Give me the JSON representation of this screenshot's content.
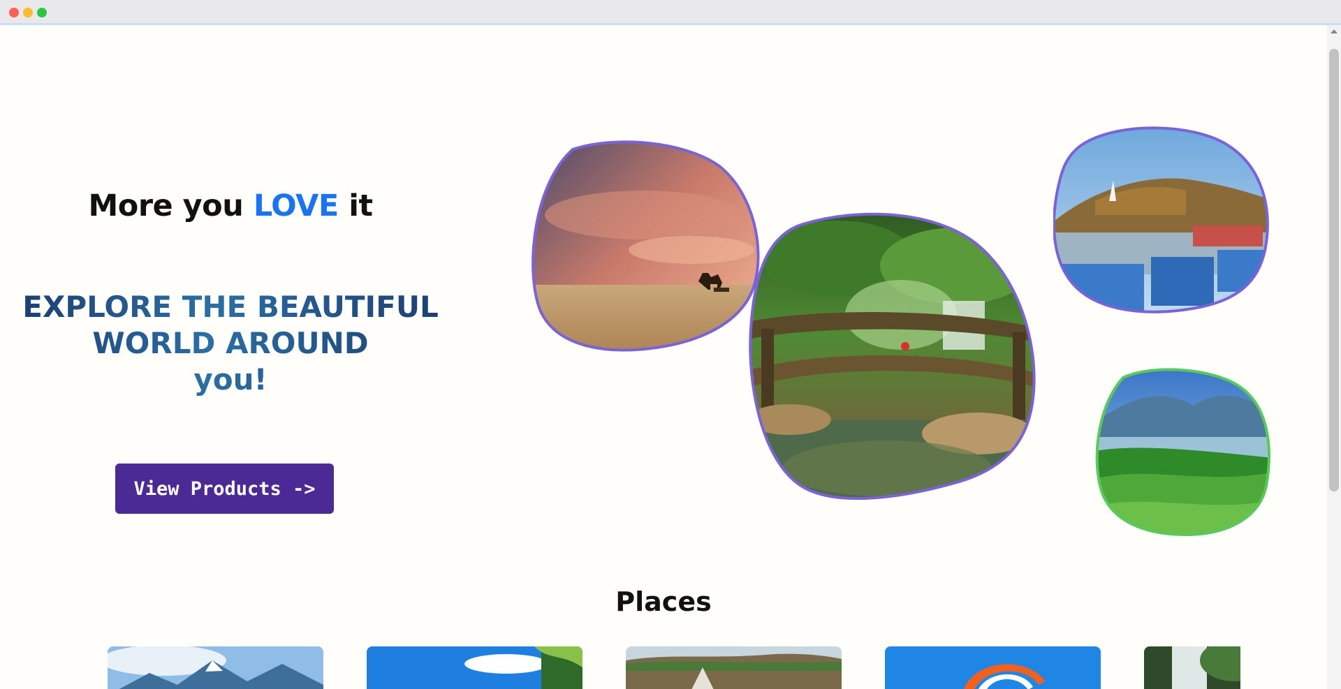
{
  "window": {
    "controls": [
      "close",
      "minimize",
      "maximize"
    ]
  },
  "hero": {
    "tagline_prefix": "More you ",
    "tagline_accent": "LOVE",
    "tagline_suffix": " it",
    "headline_line1": "EXPLORE THE BEAUTIFUL",
    "headline_line2": "WORLD AROUND",
    "headline_line3": "you!",
    "cta_label": "View Products ->"
  },
  "gallery": {
    "images": [
      {
        "name": "desert-sunset-image",
        "border_color": "#7a63d8"
      },
      {
        "name": "living-root-bridge-image",
        "border_color": "#7a63d8"
      },
      {
        "name": "lake-boat-image",
        "border_color": "#7a63d8"
      },
      {
        "name": "tea-hills-image",
        "border_color": "#59c95b"
      }
    ]
  },
  "places": {
    "title": "Places",
    "cards": [
      {
        "name": "mountain-peaks"
      },
      {
        "name": "beach-palms"
      },
      {
        "name": "canyon-falls"
      },
      {
        "name": "paragliding"
      },
      {
        "name": "waterfall-forest"
      }
    ]
  },
  "colors": {
    "accent": "#1a74f1",
    "button": "#4b2a96",
    "headline": "#1d4e7a"
  }
}
